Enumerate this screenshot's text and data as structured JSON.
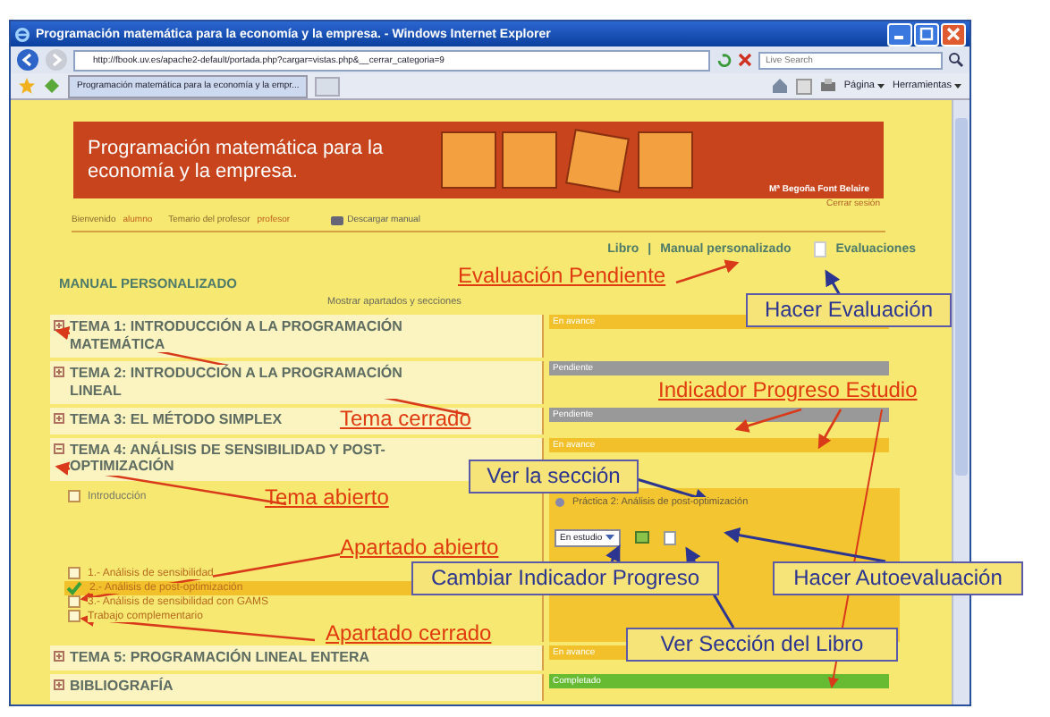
{
  "window": {
    "title": "Programación matemática para la economía y la empresa. - Windows Internet Explorer"
  },
  "address_bar": {
    "url": "http://fbook.uv.es/apache2-default/portada.php?cargar=vistas.php&__cerrar_categoria=9"
  },
  "search": {
    "placeholder": "Live Search"
  },
  "tab": {
    "label": "Programación matemática para la economía y la empr..."
  },
  "command_bar": [
    {
      "label": "Página"
    },
    {
      "label": "Herramientas"
    }
  ],
  "banner": {
    "title": "Programación matemática para la economía y la empresa.",
    "author": "Mª Begoña Font Belaire"
  },
  "logout": "Cerrar sesión",
  "nav": [
    {
      "label": "Bienvenido",
      "kind": "label"
    },
    {
      "label": "alumno",
      "kind": "value"
    },
    {
      "label": "Temario del profesor",
      "kind": "label"
    },
    {
      "label": "profesor",
      "kind": "value"
    },
    {
      "label": "Descargar manual",
      "kind": "download"
    }
  ],
  "views": [
    {
      "label": "Libro",
      "kind": "link"
    },
    {
      "label": "|",
      "kind": "separator"
    },
    {
      "label": "Manual personalizado",
      "kind": "link"
    },
    {
      "label": "Evaluaciones",
      "kind": "evaluation"
    }
  ],
  "heading": "MANUAL PERSONALIZADO",
  "toggle": "Mostrar apartados y secciones",
  "topics": [
    {
      "title": "TEMA 1: INTRODUCCIÓN A LA PROGRAMACIÓN MATEMÁTICA",
      "expanded": false,
      "status": {
        "label": "En avance",
        "kind": "progress"
      }
    },
    {
      "title": "TEMA 2: INTRODUCCIÓN A LA PROGRAMACIÓN LINEAL",
      "expanded": false,
      "status": {
        "label": "Pendiente",
        "kind": "pending"
      }
    },
    {
      "title": "TEMA 3: EL MÉTODO SIMPLEX",
      "expanded": false,
      "status": {
        "label": "Pendiente",
        "kind": "pending"
      }
    },
    {
      "title": "TEMA 4: ANÁLISIS DE SENSIBILIDAD Y POST-OPTIMIZACIÓN",
      "expanded": true,
      "status": {
        "label": "En avance",
        "kind": "progress"
      },
      "intro": {
        "label": "Introducción",
        "checked": false
      },
      "practice": {
        "link": "Práctica 2: Análisis de post-optimización",
        "progress": "En estudio"
      },
      "sections": [
        {
          "label": "1.- Análisis de sensibilidad",
          "checked": false,
          "selected": false
        },
        {
          "label": "2.- Análisis de post-optimización",
          "checked": true,
          "selected": true
        },
        {
          "label": "3.- Análisis de sensibilidad con GAMS",
          "checked": false,
          "selected": false
        },
        {
          "label": "Trabajo complementario",
          "checked": false,
          "selected": false
        }
      ]
    },
    {
      "title": "TEMA 5: PROGRAMACIÓN LINEAL ENTERA",
      "expanded": false,
      "status": {
        "label": "En avance",
        "kind": "progress"
      }
    },
    {
      "title": "BIBLIOGRAFÍA",
      "expanded": false,
      "status": {
        "label": "Completado",
        "kind": "done"
      }
    }
  ],
  "annotations": [
    {
      "text": "Evaluación Pendiente",
      "kind": "callout"
    },
    {
      "text": "Hacer Evaluación",
      "kind": "box"
    },
    {
      "text": "Tema cerrado",
      "kind": "callout"
    },
    {
      "text": "Indicador Progreso Estudio",
      "kind": "callout"
    },
    {
      "text": "Ver la sección",
      "kind": "box"
    },
    {
      "text": "Tema abierto",
      "kind": "callout"
    },
    {
      "text": "Apartado abierto",
      "kind": "callout"
    },
    {
      "text": "Cambiar Indicador Progreso",
      "kind": "box"
    },
    {
      "text": "Hacer Autoevaluación",
      "kind": "box"
    },
    {
      "text": "Apartado cerrado",
      "kind": "callout"
    },
    {
      "text": "Ver Sección del Libro",
      "kind": "box"
    }
  ]
}
